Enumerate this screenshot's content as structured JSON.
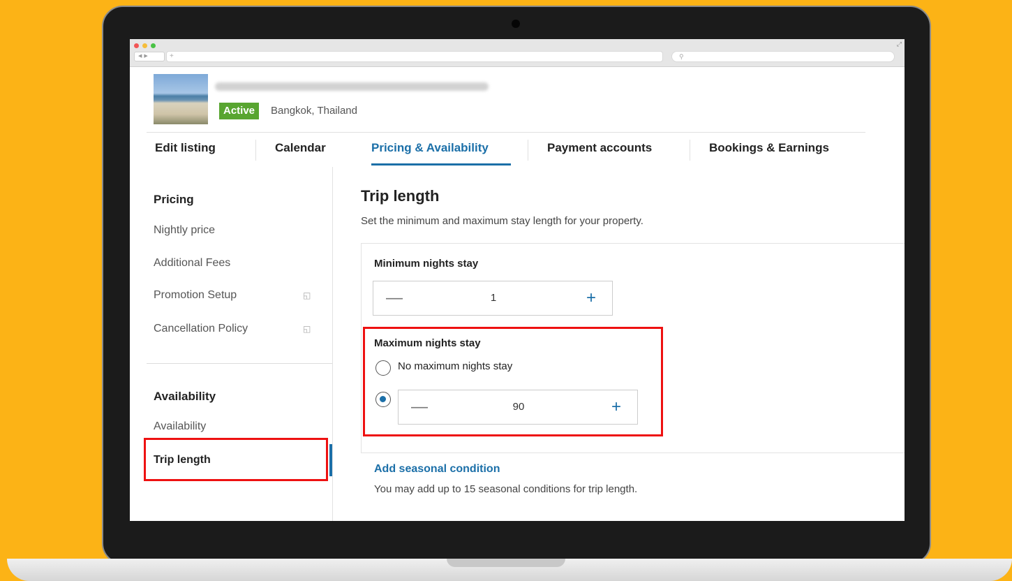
{
  "browser": {
    "tab_symbol": "+",
    "search_symbol": "⚲"
  },
  "listing": {
    "status_badge": "Active",
    "location": "Bangkok, Thailand"
  },
  "tabs": [
    {
      "label": "Edit listing"
    },
    {
      "label": "Calendar"
    },
    {
      "label": "Pricing & Availability"
    },
    {
      "label": "Payment accounts"
    },
    {
      "label": "Bookings & Earnings"
    }
  ],
  "sidebar": {
    "pricing_heading": "Pricing",
    "pricing_items": [
      {
        "label": "Nightly price"
      },
      {
        "label": "Additional Fees"
      },
      {
        "label": "Promotion Setup",
        "icon": "external-link-icon"
      },
      {
        "label": "Cancellation Policy",
        "icon": "external-link-icon"
      }
    ],
    "availability_heading": "Availability",
    "availability_items": [
      {
        "label": "Availability"
      },
      {
        "label": "Trip length"
      }
    ]
  },
  "main": {
    "title": "Trip length",
    "description": "Set the minimum and maximum stay length for your property.",
    "min_nights": {
      "label": "Minimum nights stay",
      "value": "1"
    },
    "max_nights": {
      "label": "Maximum nights stay",
      "no_max_label": "No maximum nights stay",
      "value": "90",
      "selected_option": "custom"
    },
    "add_seasonal_link": "Add seasonal condition",
    "seasonal_note": "You may add up to 15 seasonal conditions for trip length."
  },
  "colors": {
    "background": "#fcb316",
    "accent": "#1b6fa8",
    "active_badge": "#58a530",
    "highlight": "#ee1111"
  }
}
